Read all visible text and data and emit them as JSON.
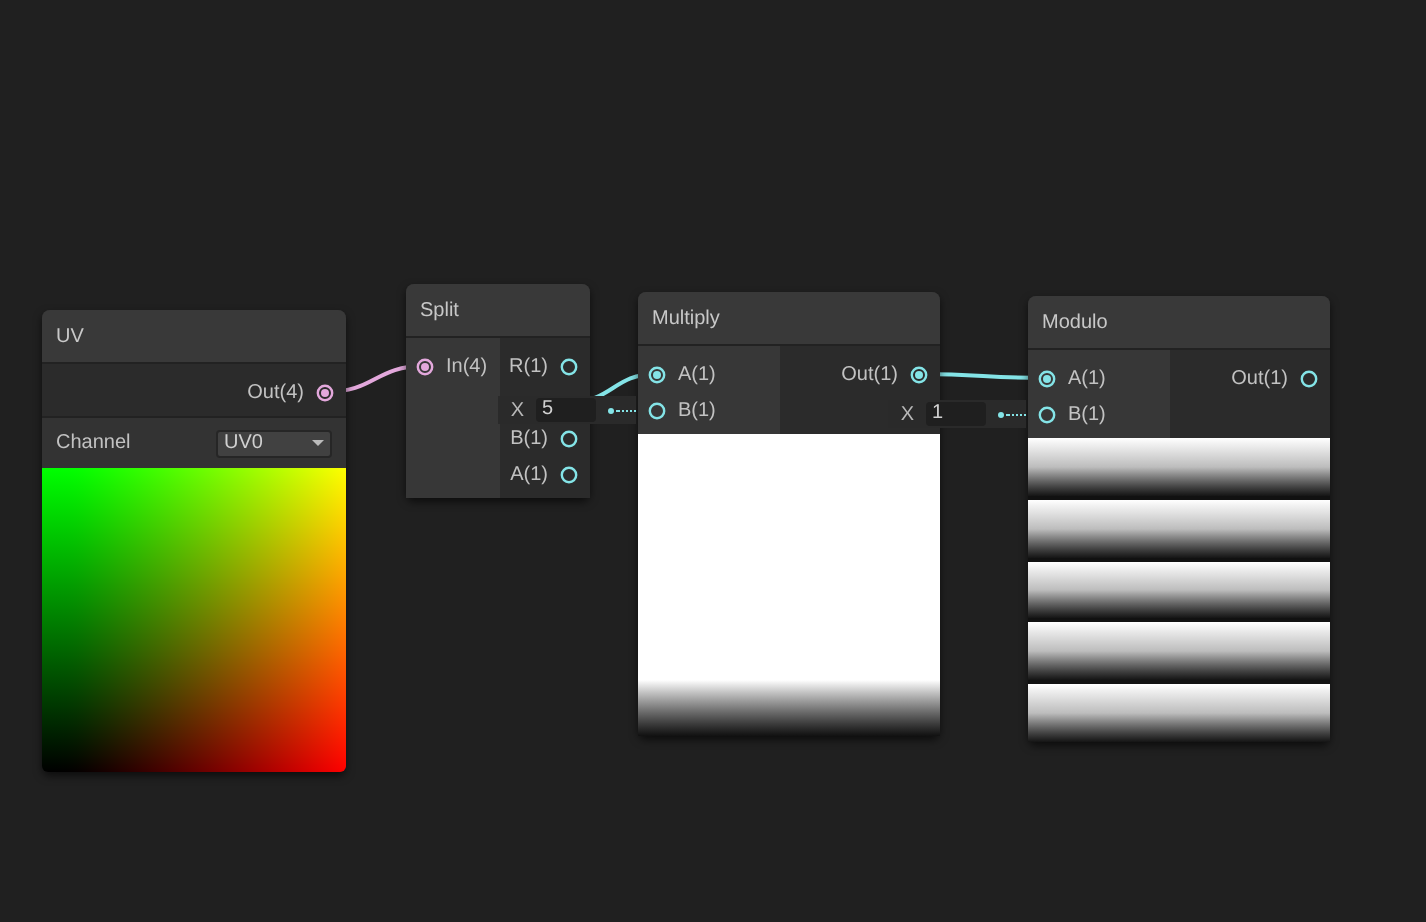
{
  "nodes": [
    {
      "title": "UV",
      "outputs": [
        {
          "kind": "port",
          "label": "Out(4)",
          "connected": true,
          "color": "#e3a8dc"
        }
      ],
      "control": {
        "label": "Channel",
        "value": "UV0"
      },
      "preview": {
        "kind": "uv"
      }
    },
    {
      "title": "Split",
      "inputs": [
        {
          "kind": "port",
          "label": "In(4)",
          "connected": true,
          "color": "#e3a8dc"
        }
      ],
      "outputs": [
        {
          "kind": "port",
          "label": "R(1)",
          "connected": false,
          "color": "#84e4e7"
        },
        {
          "kind": "covered"
        },
        {
          "kind": "port",
          "label": "B(1)",
          "connected": false,
          "color": "#84e4e7"
        },
        {
          "kind": "port",
          "label": "A(1)",
          "connected": false,
          "color": "#84e4e7"
        }
      ]
    },
    {
      "title": "Multiply",
      "inputs": [
        {
          "kind": "port",
          "label": "A(1)",
          "connected": true,
          "color": "#84e4e7"
        },
        {
          "kind": "port",
          "label": "B(1)",
          "connected": false,
          "color": "#84e4e7",
          "field": {
            "axis": "X",
            "value": "5"
          }
        }
      ],
      "outputs": [
        {
          "kind": "port",
          "label": "Out(1)",
          "connected": true,
          "color": "#84e4e7"
        }
      ],
      "preview": {
        "kind": "fade"
      }
    },
    {
      "title": "Modulo",
      "inputs": [
        {
          "kind": "port",
          "label": "A(1)",
          "connected": true,
          "color": "#84e4e7"
        },
        {
          "kind": "port",
          "label": "B(1)",
          "connected": false,
          "color": "#84e4e7",
          "field": {
            "axis": "X",
            "value": "1"
          }
        }
      ],
      "outputs": [
        {
          "kind": "port",
          "label": "Out(1)",
          "connected": false,
          "color": "#84e4e7"
        }
      ],
      "preview": {
        "kind": "stripes"
      }
    }
  ]
}
